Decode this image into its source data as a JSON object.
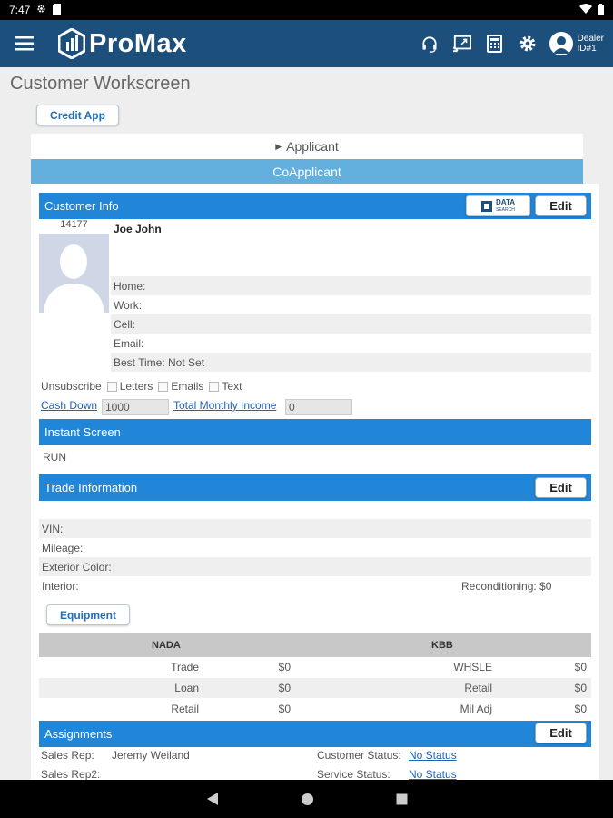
{
  "status_bar": {
    "time": "7:47"
  },
  "app": {
    "logo_text": "ProMax",
    "user_line1": "Dealer",
    "user_line2": "ID#1"
  },
  "page": {
    "title": "Customer Workscreen",
    "credit_app_label": "Credit App",
    "applicant_label": "Applicant",
    "coapplicant_label": "CoApplicant"
  },
  "customer_info": {
    "header": "Customer Info",
    "data_search_label": "DATA",
    "data_search_sub": "SEARCH",
    "edit_label": "Edit",
    "id": "14177",
    "name": "Joe John",
    "home_label": "Home:",
    "work_label": "Work:",
    "cell_label": "Cell:",
    "email_label": "Email:",
    "best_time_label": "Best Time: Not Set",
    "unsubscribe_label": "Unsubscribe",
    "letters_label": "Letters",
    "emails_label": "Emails",
    "text_label": "Text",
    "cash_down_label": "Cash Down",
    "cash_down_value": "1000",
    "total_monthly_income_label": "Total Monthly Income",
    "total_monthly_income_value": "0"
  },
  "instant_screen": {
    "header": "Instant Screen",
    "run_label": "RUN"
  },
  "trade_info": {
    "header": "Trade Information",
    "edit_label": "Edit",
    "vin_label": "VIN:",
    "mileage_label": "Mileage:",
    "exterior_color_label": "Exterior Color:",
    "interior_label": "Interior:",
    "reconditioning_label": "Reconditioning: $0",
    "equipment_label": "Equipment",
    "nada_label": "NADA",
    "kbb_label": "KBB",
    "rows": [
      {
        "nada_label": "Trade",
        "nada_value": "$0",
        "kbb_label": "WHSLE",
        "kbb_value": "$0"
      },
      {
        "nada_label": "Loan",
        "nada_value": "$0",
        "kbb_label": "Retail",
        "kbb_value": "$0"
      },
      {
        "nada_label": "Retail",
        "nada_value": "$0",
        "kbb_label": "Mil Adj",
        "kbb_value": "$0"
      }
    ]
  },
  "assignments": {
    "header": "Assignments",
    "edit_label": "Edit",
    "sales_rep_label": "Sales Rep:",
    "sales_rep_value": "Jeremy Weiland",
    "sales_rep2_label": "Sales Rep2:",
    "customer_status_label": "Customer Status:",
    "customer_status_value": "No Status",
    "service_status_label": "Service Status:",
    "service_status_value": "No Status"
  },
  "colors": {
    "app_bar": "#1c4f7c",
    "section_header": "#2185d8",
    "coapplicant_tab": "#63b0de"
  }
}
